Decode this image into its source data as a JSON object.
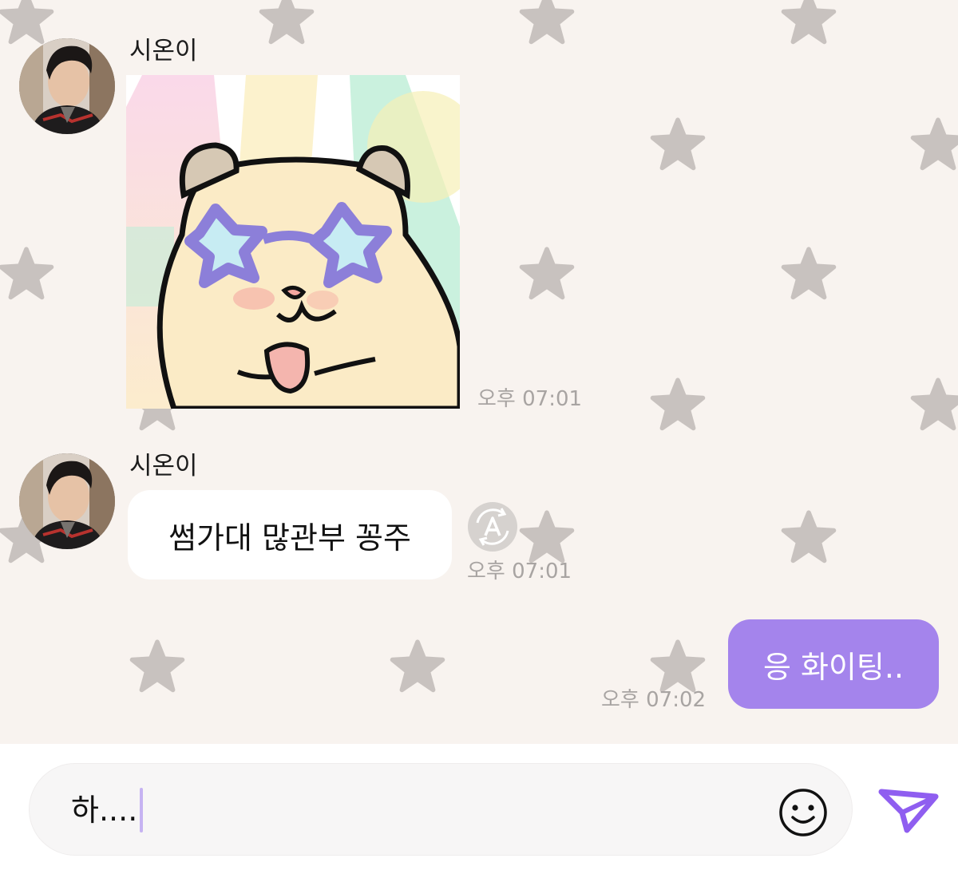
{
  "chat": {
    "messages": [
      {
        "sender": "시온이",
        "type": "sticker",
        "time": "오후 07:01"
      },
      {
        "sender": "시온이",
        "type": "text",
        "text": "썸가대 많관부 꽁주",
        "time": "오후 07:01"
      },
      {
        "sender": "me",
        "type": "text",
        "text": "응 화이팅..",
        "time": "오후 07:02"
      }
    ]
  },
  "composer": {
    "input_value": "하....",
    "emoji_icon": "smiley-face-icon",
    "send_icon": "paper-plane-icon"
  },
  "icons": {
    "translate": "translate-a-icon",
    "background": "star-icon"
  },
  "colors": {
    "chat_background": "#f8f3ef",
    "outgoing_bubble": "#a484ec",
    "incoming_bubble": "#ffffff",
    "accent": "#8f5ef0",
    "background_star": "#c8c2bf"
  }
}
